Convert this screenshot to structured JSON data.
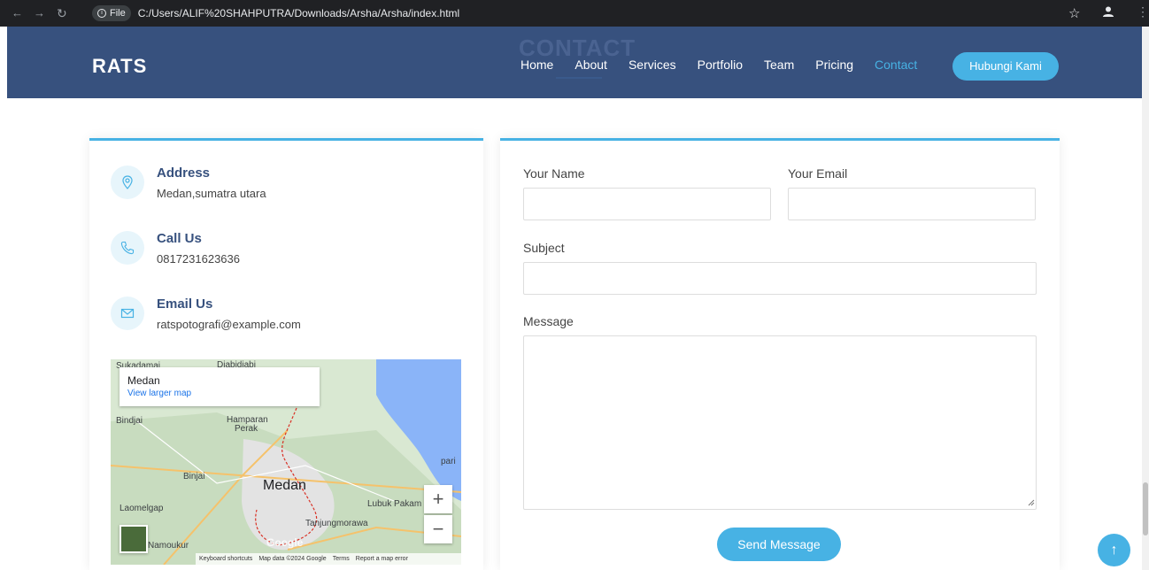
{
  "browser": {
    "file_chip": "File",
    "url": "C:/Users/ALIF%20SHAHPUTRA/Downloads/Arsha/Arsha/index.html"
  },
  "header": {
    "logo": "RATS",
    "section_ghost_title": "CONTACT",
    "nav": [
      {
        "label": "Home"
      },
      {
        "label": "About"
      },
      {
        "label": "Services"
      },
      {
        "label": "Portfolio"
      },
      {
        "label": "Team"
      },
      {
        "label": "Pricing"
      },
      {
        "label": "Contact",
        "active": true
      }
    ],
    "cta_label": "Hubungi Kami"
  },
  "info": {
    "address": {
      "title": "Address",
      "text": "Medan,sumatra utara",
      "icon": "map-pin-icon"
    },
    "call": {
      "title": "Call Us",
      "text": "0817231623636",
      "icon": "phone-icon"
    },
    "email": {
      "title": "Email Us",
      "text": "ratspotografi@example.com",
      "icon": "envelope-icon"
    }
  },
  "map": {
    "card_city": "Medan",
    "card_link": "View larger map",
    "labels": {
      "top_left": "Sukadamai",
      "top_mid": "Diabidiabi",
      "bindjai": "Bindjai",
      "hamparan": "Hamparan",
      "perak": "Perak",
      "pari": "pari",
      "binjai": "Binjai",
      "medan": "Medan",
      "laomelgap": "Laomelgap",
      "lubuk": "Lubuk Pakam",
      "tanjung": "Tanjungmorawa",
      "namoukur": "Namoukur",
      "google": "Google"
    },
    "zoom_in": "+",
    "zoom_out": "−",
    "footer": [
      "Keyboard shortcuts",
      "Map data ©2024 Google",
      "Terms",
      "Report a map error"
    ]
  },
  "form": {
    "name_label": "Your Name",
    "email_label": "Your Email",
    "subject_label": "Subject",
    "message_label": "Message",
    "name_value": "",
    "email_value": "",
    "subject_value": "",
    "message_value": "",
    "submit_label": "Send Message"
  },
  "back_to_top": "↑",
  "colors": {
    "header_bg": "#37517e",
    "accent": "#47b2e4",
    "title": "#37517e"
  }
}
